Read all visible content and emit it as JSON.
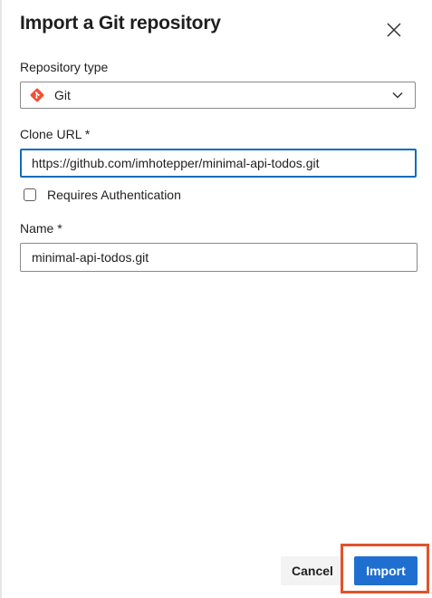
{
  "dialog": {
    "title": "Import a Git repository",
    "close_icon": "close-icon"
  },
  "repository_type": {
    "label": "Repository type",
    "selected": "Git",
    "icon": "git-icon",
    "icon_color": "#f05133"
  },
  "clone_url": {
    "label": "Clone URL *",
    "value": "https://github.com/imhotepper/minimal-api-todos.git"
  },
  "authentication": {
    "label": "Requires Authentication",
    "checked": false
  },
  "name": {
    "label": "Name *",
    "value": "minimal-api-todos.git"
  },
  "buttons": {
    "cancel": "Cancel",
    "import": "Import"
  },
  "colors": {
    "primary": "#1f6fd0",
    "focus_border": "#0f6cbd",
    "highlight": "#e2532a"
  }
}
